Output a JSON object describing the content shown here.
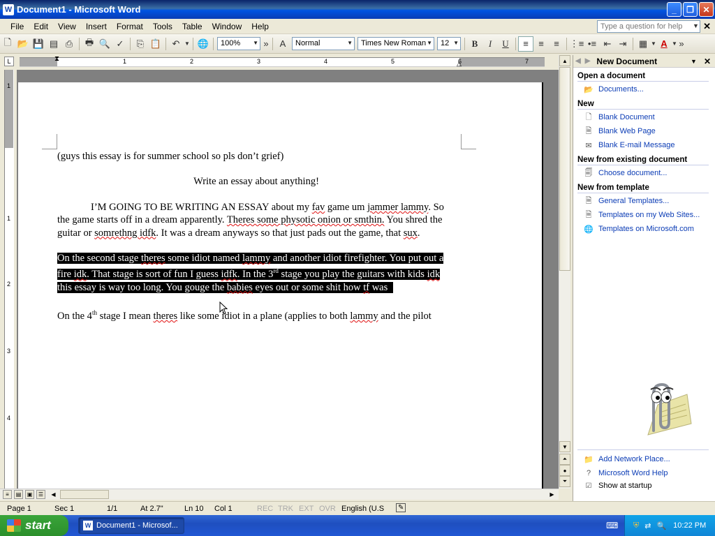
{
  "window": {
    "title": "Document1 - Microsoft Word",
    "app_icon": "W"
  },
  "menu": [
    "File",
    "Edit",
    "View",
    "Insert",
    "Format",
    "Tools",
    "Table",
    "Window",
    "Help"
  ],
  "help_box": {
    "placeholder": "Type a question for help"
  },
  "toolbar": {
    "zoom": "100%",
    "style": "Normal",
    "font": "Times New Roman",
    "size": "12",
    "bold": "B",
    "italic": "I",
    "underline": "U"
  },
  "ruler": {
    "labels": [
      "1",
      "2",
      "3",
      "4",
      "5",
      "6",
      "7"
    ],
    "vlabels": [
      "1",
      "1",
      "2",
      "3",
      "4"
    ]
  },
  "document": {
    "line1": "(guys this essay is for summer school so pls don’t grief)",
    "title": "Write an essay about anything!",
    "p1": {
      "a": "I’M GOING TO BE WRITING AN ESSAY about my ",
      "w1": "fav",
      "b": " game um ",
      "w2": "jammer lammy",
      "c": ". So the game starts off in a dream apparently. ",
      "w3": "Theres some physotic onion or smthin.",
      "d": " You shred the guitar or ",
      "w4": "somrethng idfk",
      "e": ". It was a dream anyways so that just pads out the game, that ",
      "w5": "sux",
      "f": "."
    },
    "p2": {
      "a": "On the second stage ",
      "w1": "theres",
      "b": " some idiot named ",
      "w2": "lammy",
      "c": " and another idiot firefighter. You put out a fire ",
      "w3": "idk",
      "d": ". That stage is sort of fun I guess ",
      "w4": "idfk",
      "e": ". In the 3",
      "sup": "rd",
      "f": " stage you play the guitars with kids ",
      "w5": "idk",
      "g": " this essay is way too long. You gouge the ",
      "w6": "babies",
      "h": " eyes out or some shit how ",
      "w7": "tf",
      "i": " was"
    },
    "p3": {
      "a": "On the 4",
      "sup": "th",
      "b": " stage I mean ",
      "w1": "theres",
      "c": " like some idiot in a plane (applies to both ",
      "w2": "lammy",
      "d": " and the pilot"
    }
  },
  "status": {
    "page": "Page 1",
    "sec": "Sec 1",
    "pages": "1/1",
    "at": "At 2.7\"",
    "ln": "Ln 10",
    "col": "Col 1",
    "rec": "REC",
    "trk": "TRK",
    "ext": "EXT",
    "ovr": "OVR",
    "lang": "English (U.S"
  },
  "taskpane": {
    "title": "New Document",
    "open_heading": "Open a document",
    "documents_link": "Documents...",
    "new_heading": "New",
    "blank_document": "Blank Document",
    "blank_web_page": "Blank Web Page",
    "blank_email": "Blank E-mail Message",
    "from_existing_heading": "New from existing document",
    "choose_document": "Choose document...",
    "from_template_heading": "New from template",
    "general_templates": "General Templates...",
    "templates_web_sites": "Templates on my Web Sites...",
    "templates_microsoft": "Templates on Microsoft.com",
    "add_network_place": "Add Network Place...",
    "word_help": "Microsoft Word Help",
    "show_at_startup": "Show at startup"
  },
  "taskbar": {
    "start": "start",
    "task": "Document1 - Microsof...",
    "clock": "10:22 PM"
  }
}
